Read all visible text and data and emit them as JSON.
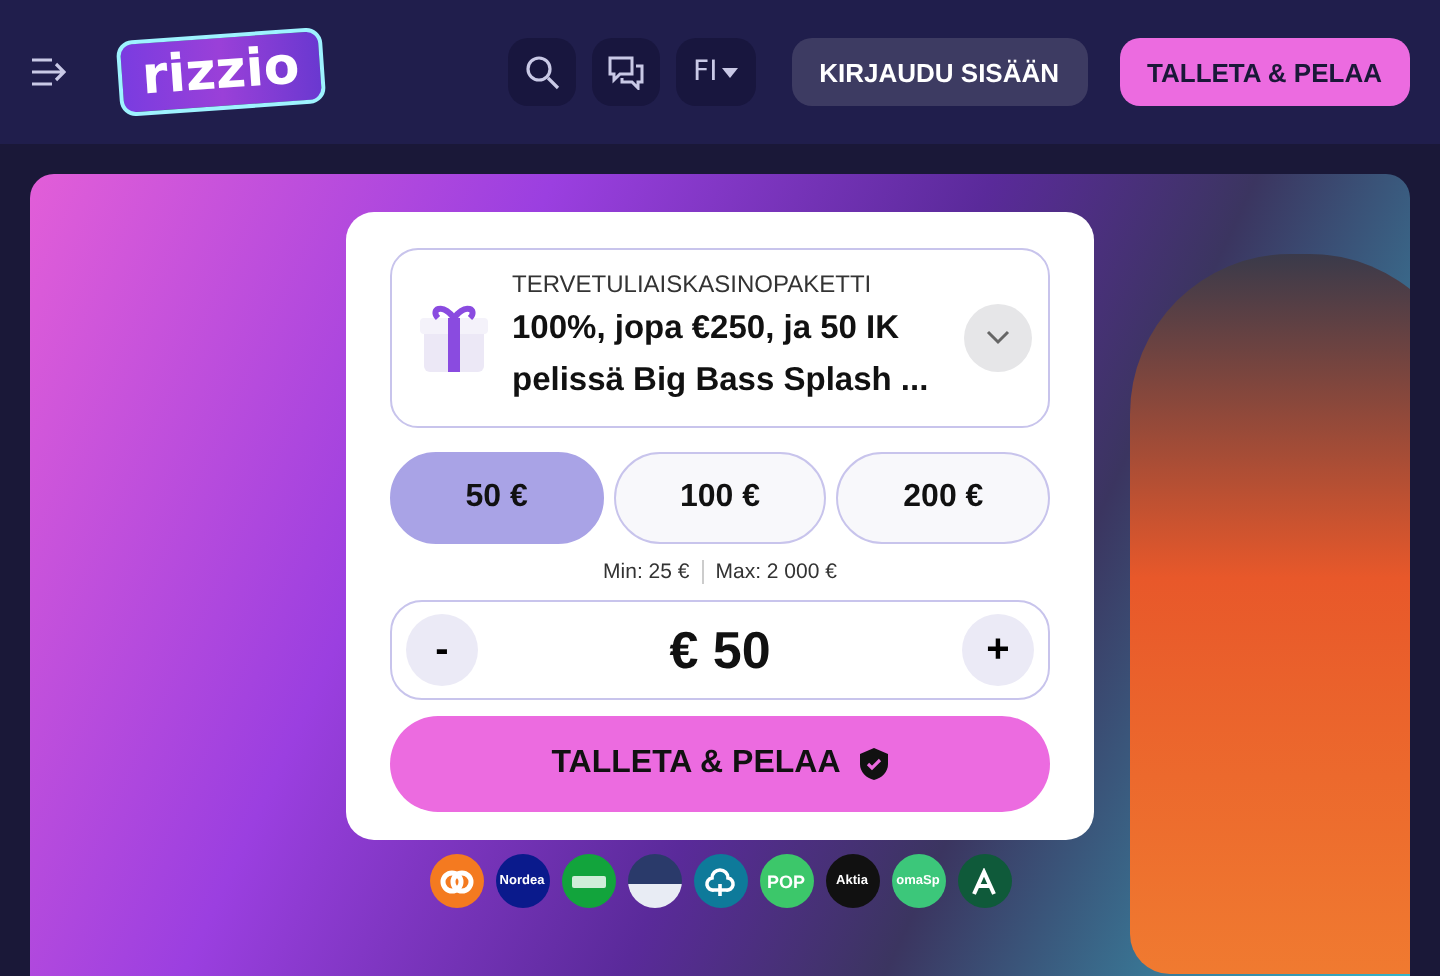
{
  "header": {
    "logo": "rizzio",
    "language": "FI",
    "login_button": "KIRJAUDU SISÄÄN",
    "deposit_button": "TALLETA & PELAA"
  },
  "offer": {
    "title": "TERVETULIAISKASINOPAKETTI",
    "description": "100%, jopa €250, ja 50 IK pelissä Big Bass Splash ...",
    "expanded": false
  },
  "amounts": [
    {
      "label": "50 €",
      "selected": true
    },
    {
      "label": "100 €",
      "selected": false
    },
    {
      "label": "200 €",
      "selected": false
    }
  ],
  "limits": {
    "min": "Min: 25 €",
    "max": "Max: 2 000 €"
  },
  "stepper": {
    "minus": "-",
    "value": "€ 50",
    "plus": "+"
  },
  "submit_button": "TALLETA & PELAA",
  "banks": [
    {
      "color": "#f47a20",
      "kind": "op"
    },
    {
      "label": "Nordea",
      "color": "#0a1a8c",
      "kind": "text"
    },
    {
      "color": "#12a43c",
      "kind": "leaf"
    },
    {
      "color": "#e8ecf4",
      "kind": "split"
    },
    {
      "color": "#0e7a9a",
      "kind": "tree"
    },
    {
      "label": "POP",
      "color": "#3cc76a",
      "kind": "text"
    },
    {
      "label": "Aktia",
      "color": "#111111",
      "kind": "text"
    },
    {
      "label": "omaSp",
      "color": "#3cc77a",
      "kind": "text"
    },
    {
      "color": "#0f5a3a",
      "kind": "a"
    }
  ]
}
